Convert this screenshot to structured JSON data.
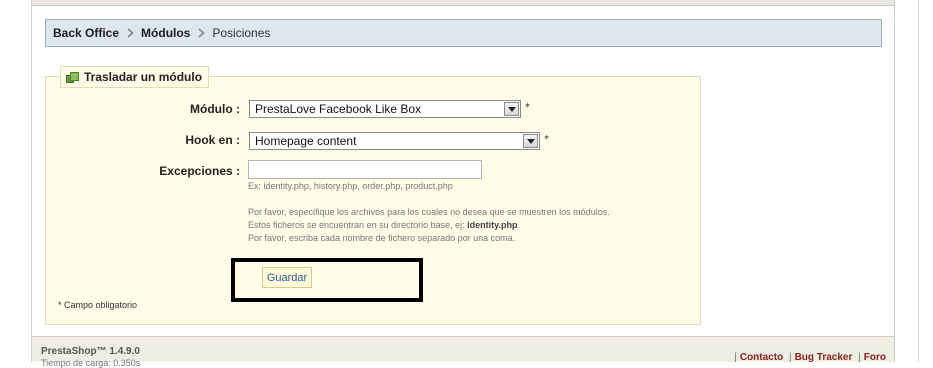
{
  "breadcrumb": {
    "items": [
      "Back Office",
      "Módulos",
      "Posiciones"
    ]
  },
  "form": {
    "legend": "Trasladar un módulo",
    "module_label": "Módulo :",
    "module_value": "PrestaLove Facebook Like Box",
    "hook_label": "Hook en :",
    "hook_value": "Homepage content",
    "required_mark": "*",
    "exceptions_label": "Excepciones :",
    "exceptions_value": "",
    "exceptions_example": "Ex: identity.php, history.php, order.php, product.php",
    "help_line1": "Por favor, especifique los archivos para los cuales no desea que se muestren los módulos.",
    "help_line2_prefix": "Estos ficheros se encuentran en su directorio base, ej: ",
    "help_line2_file": "identity.php",
    "help_line2_suffix": ".",
    "help_line3": "Por favor, escriba cada nombre de fichero separado por una coma.",
    "save_label": "Guardar",
    "required_note": "* Campo obligatorio"
  },
  "footer": {
    "brand": "PrestaShop™ 1.4.9.0",
    "time_text": "Tiempo de carga: 0.350s",
    "links": [
      "Contacto",
      "Bug Tracker",
      "Foro"
    ]
  },
  "colors": {
    "breadcrumb_bg": "#dde7ec",
    "form_bg": "#fffde8",
    "link": "#8a1f1f"
  }
}
